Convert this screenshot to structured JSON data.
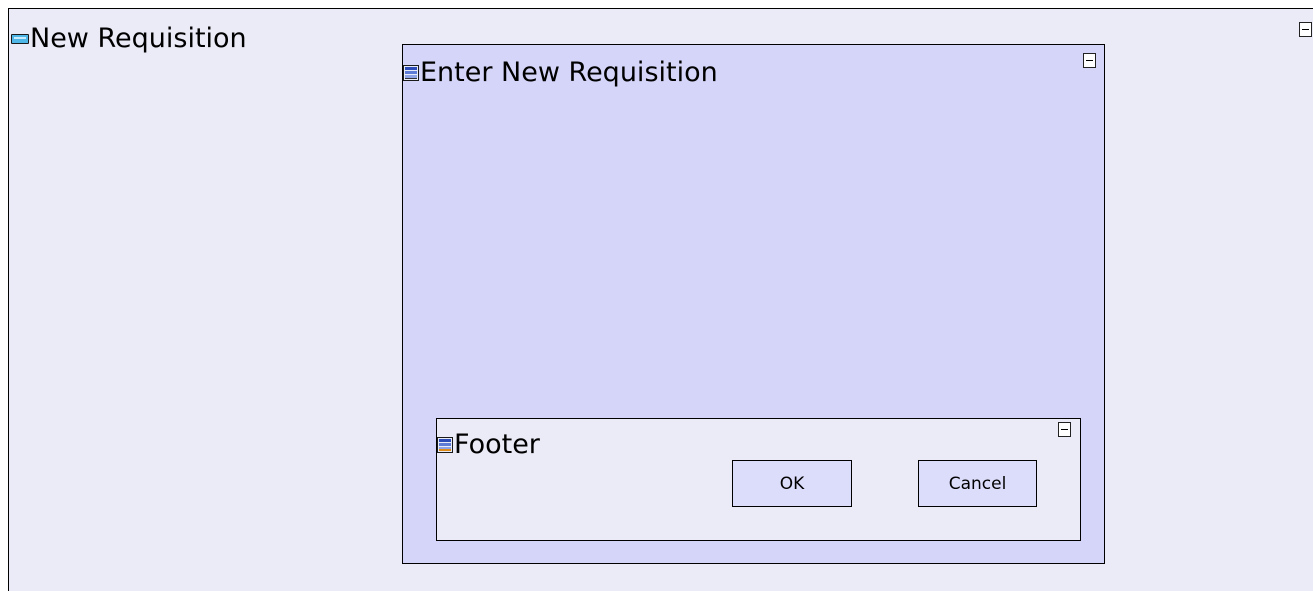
{
  "outer_panel": {
    "title": "New Requisition",
    "icon": "form-icon",
    "collapse_icon": "collapse-icon"
  },
  "inner_panel": {
    "title": "Enter New Requisition",
    "icon": "panel-icon",
    "collapse_icon": "collapse-icon"
  },
  "footer_panel": {
    "title": "Footer",
    "icon": "footer-panel-icon",
    "collapse_icon": "collapse-icon",
    "ok_label": "OK",
    "cancel_label": "Cancel"
  },
  "colors": {
    "outer_background": "#ebebf8",
    "inner_background": "#d5d5fa",
    "button_background": "#dcdcfb",
    "border": "#000000"
  }
}
